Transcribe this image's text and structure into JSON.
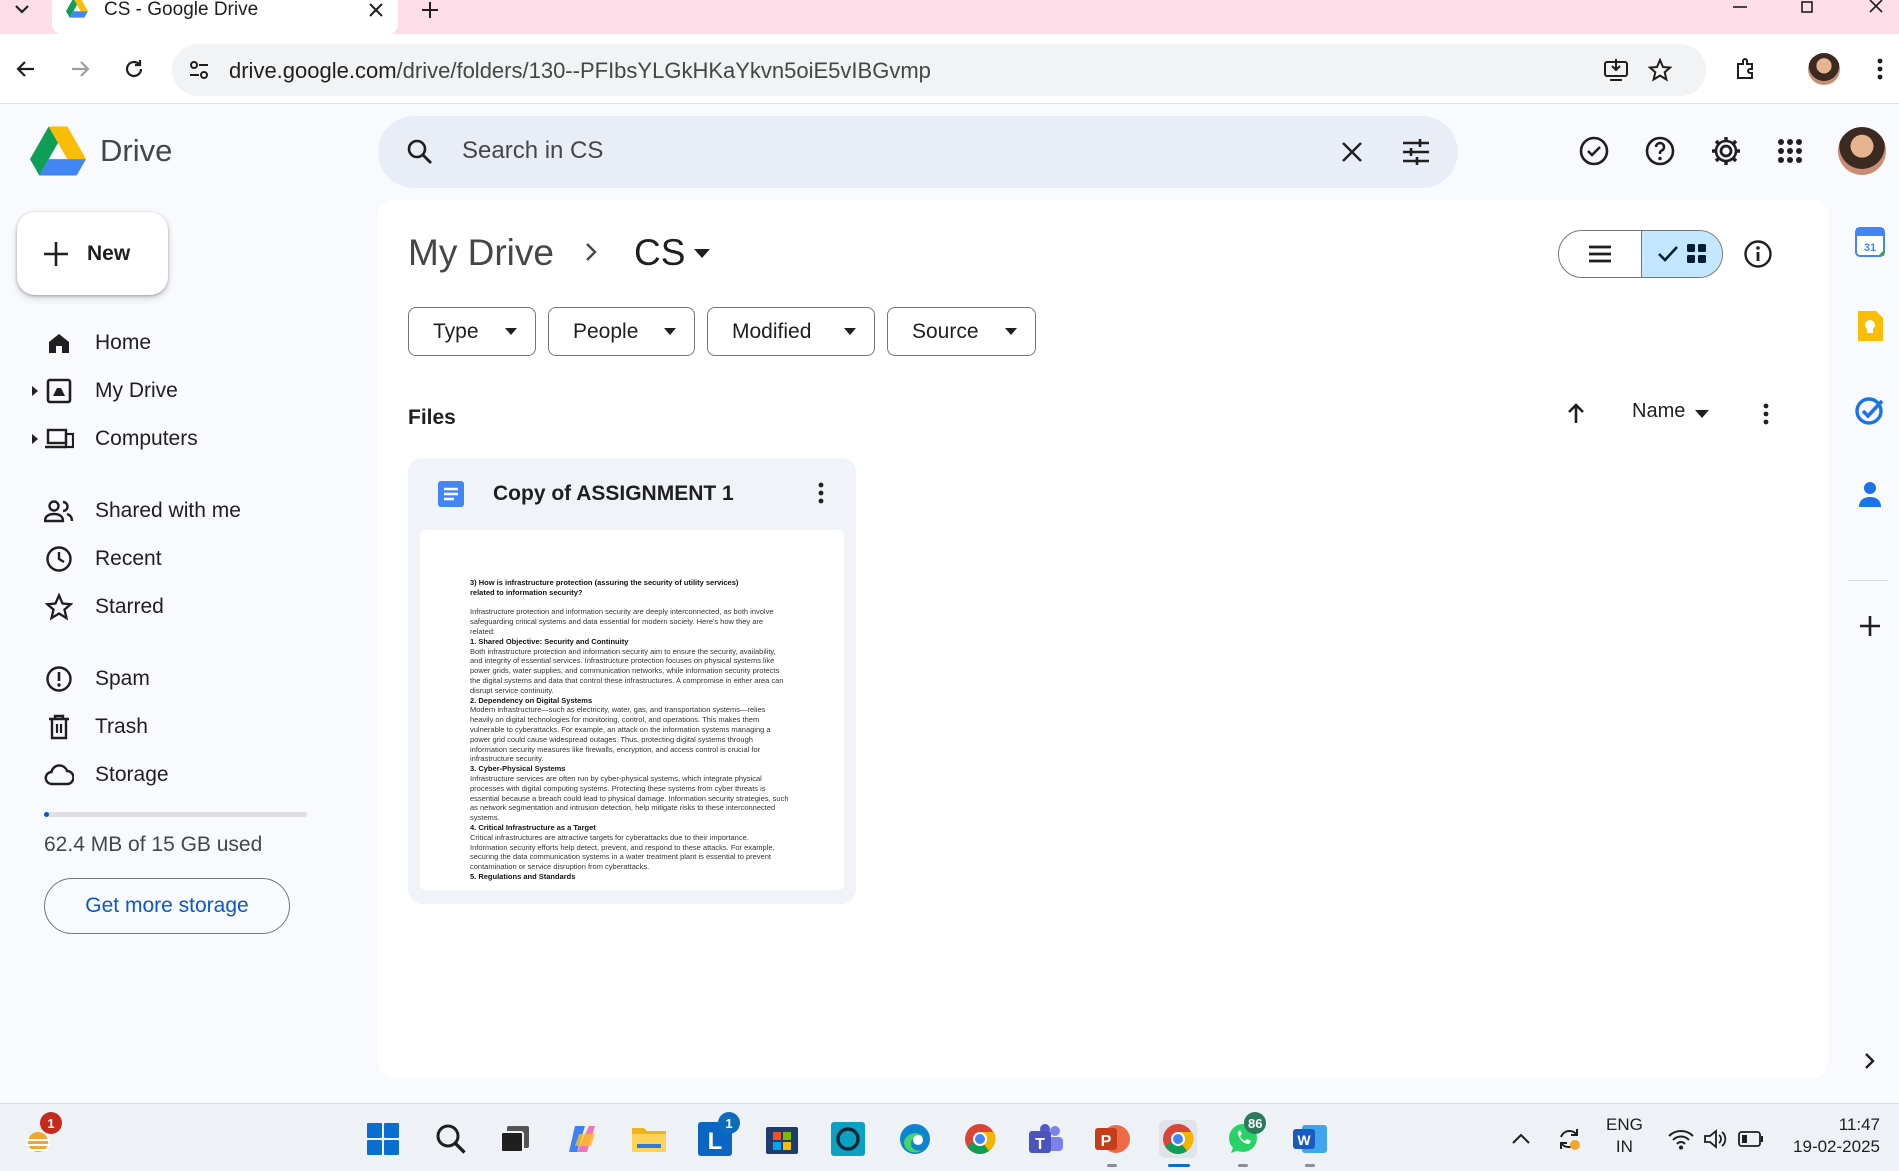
{
  "browser": {
    "tab_title": "CS - Google Drive",
    "url_host": "drive.google.com",
    "url_path": "/drive/folders/130--PFIbsYLGkHKaYkvn5oiE5vIBGvmp"
  },
  "app": {
    "name": "Drive",
    "search_placeholder": "Search in CS"
  },
  "sidebar": {
    "new_label": "New",
    "items": [
      {
        "label": "Home",
        "icon": "home-icon"
      },
      {
        "label": "My Drive",
        "icon": "my-drive-icon"
      },
      {
        "label": "Computers",
        "icon": "computers-icon"
      },
      {
        "label": "Shared with me",
        "icon": "shared-icon"
      },
      {
        "label": "Recent",
        "icon": "clock-icon"
      },
      {
        "label": "Starred",
        "icon": "star-icon"
      },
      {
        "label": "Spam",
        "icon": "spam-icon"
      },
      {
        "label": "Trash",
        "icon": "trash-icon"
      },
      {
        "label": "Storage",
        "icon": "cloud-icon"
      }
    ],
    "storage_used_fraction": 0.004,
    "storage_text": "62.4 MB of 15 GB used",
    "get_storage_label": "Get more storage"
  },
  "main": {
    "breadcrumb": [
      "My Drive",
      "CS"
    ],
    "filters": [
      "Type",
      "People",
      "Modified",
      "Source"
    ],
    "section_title": "Files",
    "sort_label": "Name",
    "files": [
      {
        "name": "Copy of ASSIGNMENT 1",
        "type": "google-docs",
        "preview": [
          {
            "text": "3)   How is infrastructure protection (assuring the security of utility    services)",
            "bold": true
          },
          {
            "text": "related to information security?",
            "bold": true
          },
          {
            "text": "",
            "bold": false
          },
          {
            "text": "Infrastructure protection and information security are deeply interconnected, as both involve",
            "bold": false
          },
          {
            "text": "safeguarding critical systems and data essential for modern society. Here's how they are",
            "bold": false
          },
          {
            "text": "related:",
            "bold": false
          },
          {
            "text": " 1. Shared Objective: Security and Continuity",
            "bold": true
          },
          {
            "text": "   Both infrastructure protection and information security aim to ensure the security, availability,",
            "bold": false
          },
          {
            "text": "and integrity of essential services. Infrastructure protection focuses on physical systems like",
            "bold": false
          },
          {
            "text": "power grids, water supplies, and communication networks, while information security protects",
            "bold": false
          },
          {
            "text": "the digital systems and data that control these infrastructures. A compromise in either area can",
            "bold": false
          },
          {
            "text": "disrupt service continuity.",
            "bold": false
          },
          {
            "text": " 2. Dependency on Digital Systems",
            "bold": true
          },
          {
            "text": "   Modern infrastructure—such as electricity, water, gas, and transportation systems—relies",
            "bold": false
          },
          {
            "text": "heavily on digital technologies for monitoring, control, and operations. This makes them",
            "bold": false
          },
          {
            "text": "vulnerable to cyberattacks. For example, an attack on the information systems managing a",
            "bold": false
          },
          {
            "text": "power grid could cause widespread outages. Thus, protecting digital systems through",
            "bold": false
          },
          {
            "text": "information security measures like firewalls, encryption, and access control is crucial for",
            "bold": false
          },
          {
            "text": "infrastructure security.",
            "bold": false
          },
          {
            "text": " 3. Cyber-Physical Systems",
            "bold": true
          },
          {
            "text": "   Infrastructure services are often run by cyber-physical systems, which integrate physical",
            "bold": false
          },
          {
            "text": "processes with digital computing systems. Protecting these systems from cyber threats is",
            "bold": false
          },
          {
            "text": "essential because a breach could lead to physical damage. Information security strategies, such",
            "bold": false
          },
          {
            "text": "as network segmentation and intrusion detection, help mitigate risks to these interconnected",
            "bold": false
          },
          {
            "text": "systems.",
            "bold": false
          },
          {
            "text": " 4. Critical Infrastructure as a Target",
            "bold": true
          },
          {
            "text": "   Critical infrastructures are attractive targets for cyberattacks due to their importance.",
            "bold": false
          },
          {
            "text": "Information security efforts help detect, prevent, and respond to these attacks. For example,",
            "bold": false
          },
          {
            "text": "securing the data communication systems in a water treatment plant is essential to prevent",
            "bold": false
          },
          {
            "text": "contamination or service disruption from cyberattacks.",
            "bold": false
          },
          {
            "text": " 5. Regulations and Standards",
            "bold": true
          }
        ]
      }
    ]
  },
  "taskbar": {
    "weather_badge": "1",
    "linkedin_badge": "1",
    "whatsapp_badge": "86",
    "lang_line1": "ENG",
    "lang_line2": "IN",
    "time": "11:47",
    "date": "19-02-2025"
  },
  "colors": {
    "accent": "#0b57d0",
    "tabstrip": "#fcdde8",
    "selected_view": "#c2e7ff",
    "card_bg": "#f0f4f9"
  }
}
